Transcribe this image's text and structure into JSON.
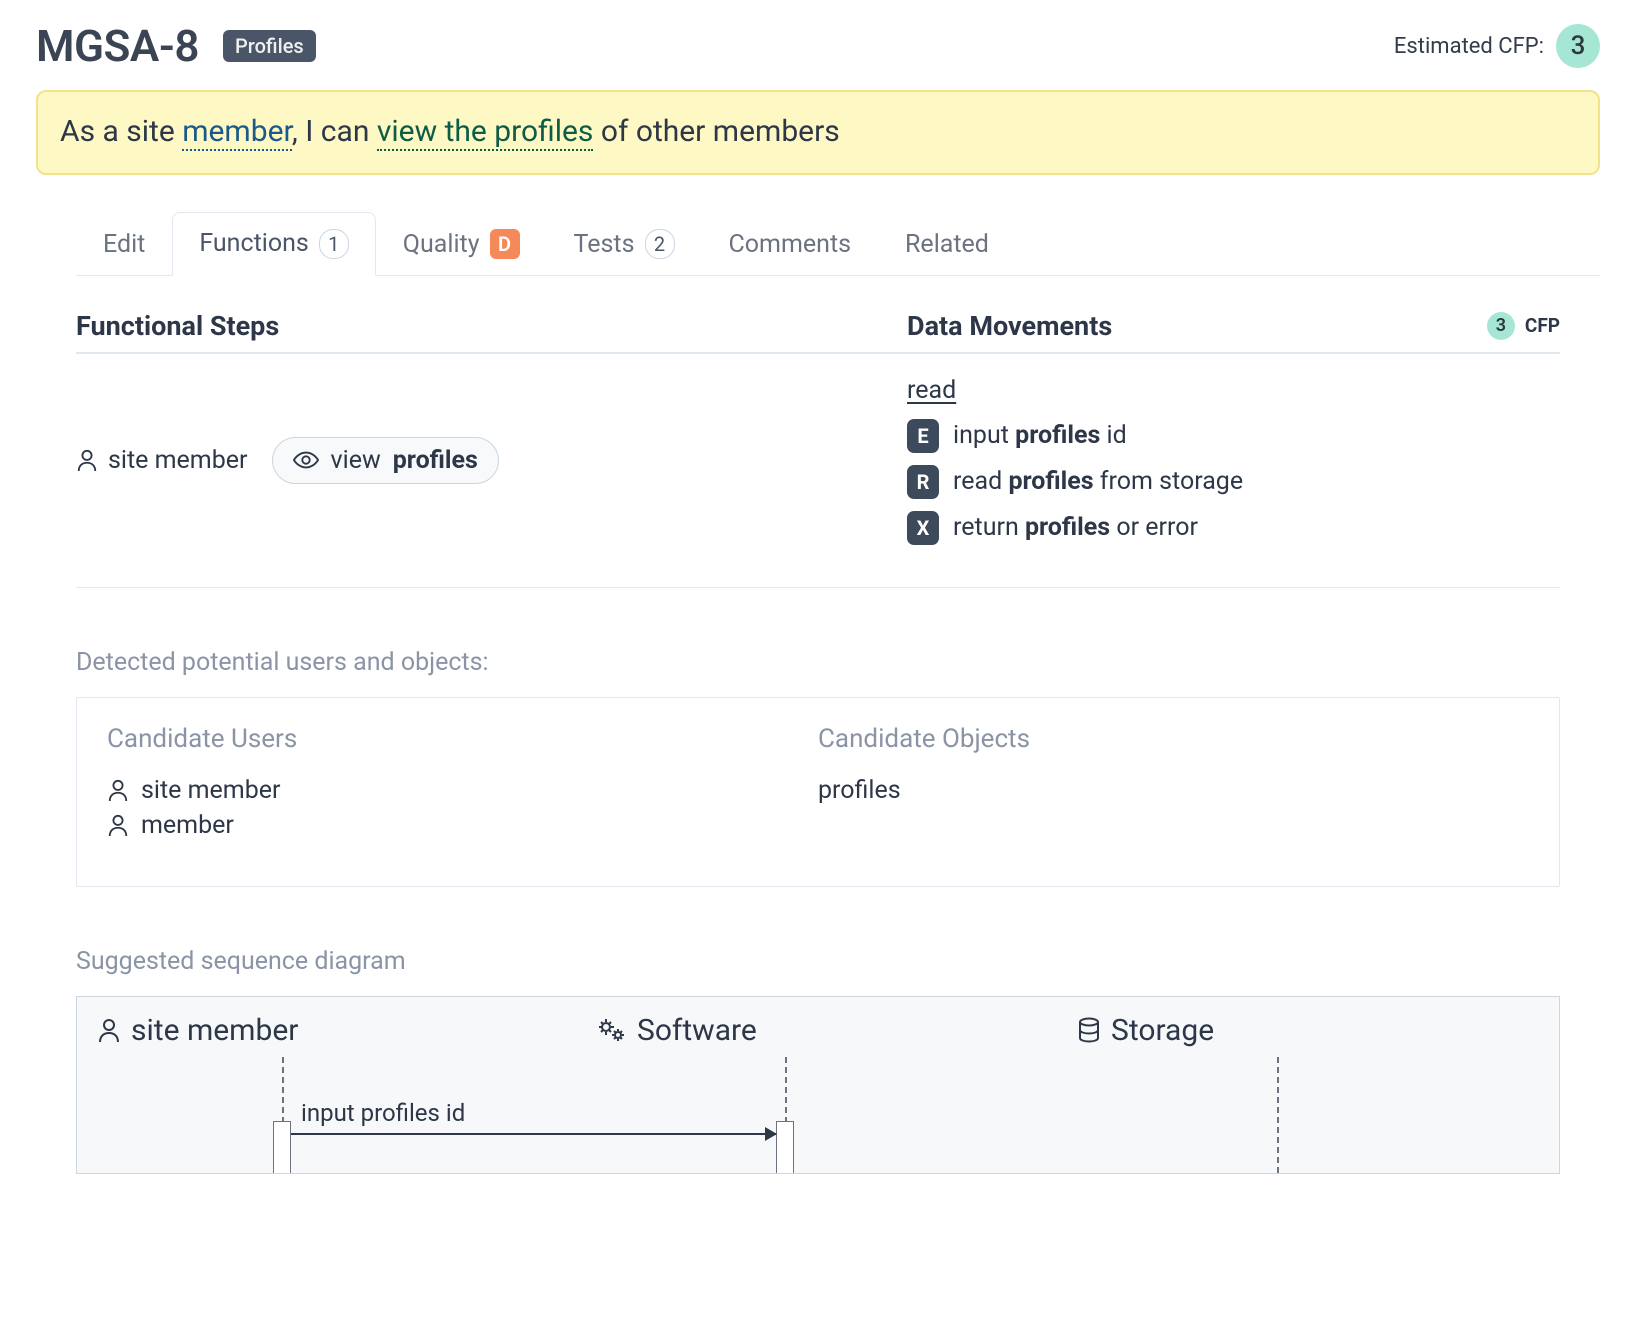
{
  "header": {
    "title": "MGSA-8",
    "tag": "Profiles",
    "cfp_label": "Estimated CFP:",
    "cfp_value": "3"
  },
  "story": {
    "prefix": "As a site ",
    "user_term": "member",
    "mid": ", I can ",
    "object_term": "view the profiles",
    "suffix": " of other members"
  },
  "tabs": {
    "edit": "Edit",
    "functions": "Functions",
    "functions_count": "1",
    "quality": "Quality",
    "quality_grade": "D",
    "tests": "Tests",
    "tests_count": "2",
    "comments": "Comments",
    "related": "Related"
  },
  "fn_panel": {
    "steps_label": "Functional Steps",
    "movements_label": "Data Movements",
    "cfp_value": "3",
    "cfp_unit": "CFP",
    "user": "site member",
    "action_verb": "view",
    "action_object": "profiles",
    "dm_title": "read",
    "rows": [
      {
        "badge": "E",
        "pre": "input ",
        "bold": "profiles",
        "post": " id"
      },
      {
        "badge": "R",
        "pre": "read ",
        "bold": "profiles",
        "post": " from storage"
      },
      {
        "badge": "X",
        "pre": "return ",
        "bold": "profiles",
        "post": " or error"
      }
    ]
  },
  "detected": {
    "label": "Detected potential users and objects:",
    "users_head": "Candidate Users",
    "objects_head": "Candidate Objects",
    "users": [
      "site member",
      "member"
    ],
    "objects": [
      "profiles"
    ]
  },
  "sequence": {
    "label": "Suggested sequence diagram",
    "col1": "site member",
    "col2": "Software",
    "col3": "Storage",
    "msg1": "input profiles id"
  }
}
